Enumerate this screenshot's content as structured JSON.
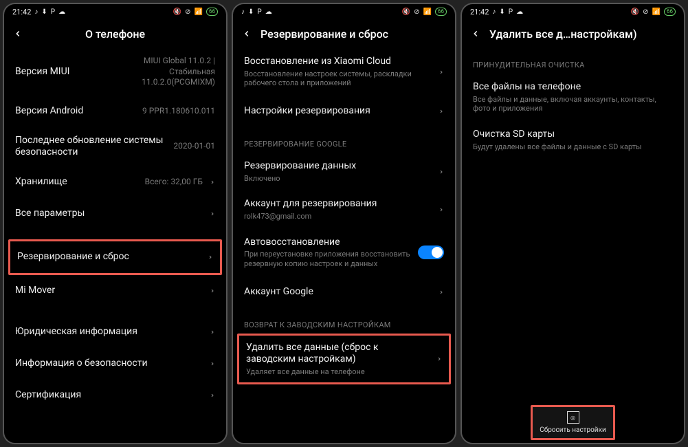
{
  "status": {
    "time": "21:42",
    "left_icons": [
      "tiktok-icon",
      "download-icon",
      "p-icon",
      "cloud-icon"
    ],
    "right_icons": [
      "mute-icon",
      "no-sim-icon",
      "signal-icon"
    ],
    "battery": "66"
  },
  "screen1": {
    "title": "О телефоне",
    "rows": [
      {
        "label": "Версия MIUI",
        "value": "MIUI Global 11.0.2 | Стабильная 11.0.2.0(PCGMIXM)"
      },
      {
        "label": "Версия Android",
        "value": "9 PPR1.180610.011"
      },
      {
        "label": "Последнее обновление системы безопасности",
        "value": "2020-01-01"
      },
      {
        "label": "Хранилище",
        "value": "Всего: 32,00 ГБ",
        "chevron": true
      },
      {
        "label": "Все параметры",
        "chevron": true
      },
      {
        "label": "Резервирование и сброс",
        "chevron": true,
        "highlighted": true
      },
      {
        "label": "Mi Mover",
        "chevron": true
      },
      {
        "label": "Юридическая информация",
        "chevron": true
      },
      {
        "label": "Информация о безопасности",
        "chevron": true
      },
      {
        "label": "Сертификация",
        "chevron": true
      }
    ]
  },
  "screen2": {
    "title": "Резервирование и сброс",
    "group0": {
      "rows": [
        {
          "label": "Восстановление из Xiaomi Cloud",
          "sub": "Восстановление настроек системы, раскладки рабочего стола и приложений",
          "chevron": true
        },
        {
          "label": "Настройки резервирования",
          "chevron": true
        }
      ]
    },
    "group1": {
      "header": "РЕЗЕРВИРОВАНИЕ GOOGLE",
      "rows": [
        {
          "label": "Резервирование данных",
          "sub": "Включено",
          "chevron": true
        },
        {
          "label": "Аккаунт для резервирования",
          "sub": "rolk473@gmail.com",
          "chevron": true
        },
        {
          "label": "Автовосстановление",
          "sub": "При переустановке приложения восстановить резервную копию настроек и данных",
          "toggle": true
        },
        {
          "label": "Аккаунт Google",
          "chevron": true
        }
      ]
    },
    "group2": {
      "header": "ВОЗВРАТ К ЗАВОДСКИМ НАСТРОЙКАМ",
      "rows": [
        {
          "label": "Удалить все данные (сброс к заводским настройкам)",
          "sub": "Удаляет все данные на телефоне",
          "chevron": true,
          "highlighted": true
        }
      ]
    }
  },
  "screen3": {
    "title": "Удалить все д…настройкам)",
    "section_header": "ПРИНУДИТЕЛЬНАЯ ОЧИСТКА",
    "rows": [
      {
        "label": "Все файлы на телефоне",
        "sub": "Все файлы и данные, включая аккаунты, контакты, фото и приложения"
      },
      {
        "label": "Очистка SD карты",
        "sub": "Будут удалены все файлы и данные с SD карты"
      }
    ],
    "action": {
      "label": "Сбросить настройки",
      "highlighted": true
    }
  }
}
